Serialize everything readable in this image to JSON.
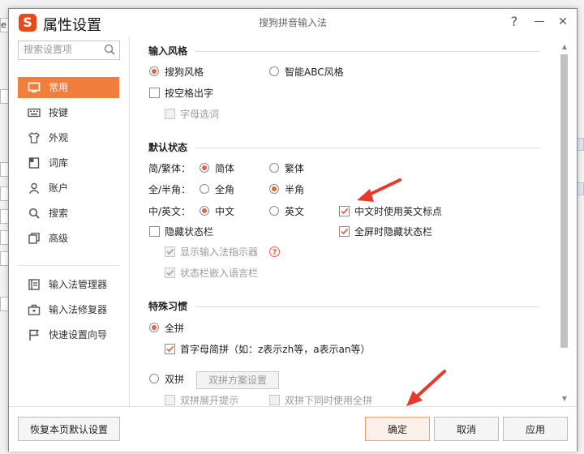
{
  "window": {
    "title": "属性设置",
    "subtitle": "搜狗拼音输入法",
    "logo_text": "S",
    "help_glyph": "?",
    "minimize_glyph": "—",
    "close_glyph": "✕"
  },
  "background": {
    "left_fragments": [
      "e",
      "",
      "",
      "",
      "",
      "",
      "",
      ""
    ]
  },
  "sidebar": {
    "search_placeholder": "搜索设置项",
    "items": [
      {
        "label": "常用",
        "icon": "monitor-icon",
        "active": true
      },
      {
        "label": "按键",
        "icon": "keyboard-icon",
        "active": false
      },
      {
        "label": "外观",
        "icon": "shirt-icon",
        "active": false
      },
      {
        "label": "词库",
        "icon": "book-icon",
        "active": false
      },
      {
        "label": "账户",
        "icon": "user-icon",
        "active": false
      },
      {
        "label": "搜索",
        "icon": "search-icon",
        "active": false
      },
      {
        "label": "高级",
        "icon": "layers-icon",
        "active": false
      }
    ],
    "tools": [
      {
        "label": "输入法管理器",
        "icon": "manager-icon"
      },
      {
        "label": "输入法修复器",
        "icon": "toolbox-icon"
      },
      {
        "label": "快速设置向导",
        "icon": "flag-icon"
      }
    ]
  },
  "sections": {
    "input_style": {
      "title": "输入风格",
      "sogou_style": "搜狗风格",
      "abc_style": "智能ABC风格",
      "space_output": "按空格出字",
      "letter_candidate": "字母选词"
    },
    "default_state": {
      "title": "默认状态",
      "simp_trad_label": "简/繁体：",
      "simplified": "简体",
      "traditional": "繁体",
      "width_label": "全/半角：",
      "full_width": "全角",
      "half_width": "半角",
      "cn_en_label": "中/英文：",
      "chinese": "中文",
      "english": "英文",
      "cn_use_en_punct": "中文时使用英文标点",
      "hide_status_bar": "隐藏状态栏",
      "fullscreen_hide_status": "全屏时隐藏状态栏",
      "show_indicator": "显示输入法指示器",
      "embed_langbar": "状态栏嵌入语言栏"
    },
    "special_habits": {
      "title": "特殊习惯",
      "full_pinyin": "全拼",
      "initial_abbr": "首字母简拼（如：z表示zh等，a表示an等）",
      "double_pinyin": "双拼",
      "scheme_settings": "双拼方案设置",
      "double_expand_hint": "双拼展开提示",
      "double_also_full": "双拼下同时使用全拼"
    }
  },
  "footer": {
    "restore_defaults": "恢复本页默认设置",
    "ok": "确定",
    "cancel": "取消",
    "apply": "应用"
  },
  "colors": {
    "accent": "#f27e3b",
    "check": "#e8623a",
    "arrow": "#e83a2a"
  }
}
